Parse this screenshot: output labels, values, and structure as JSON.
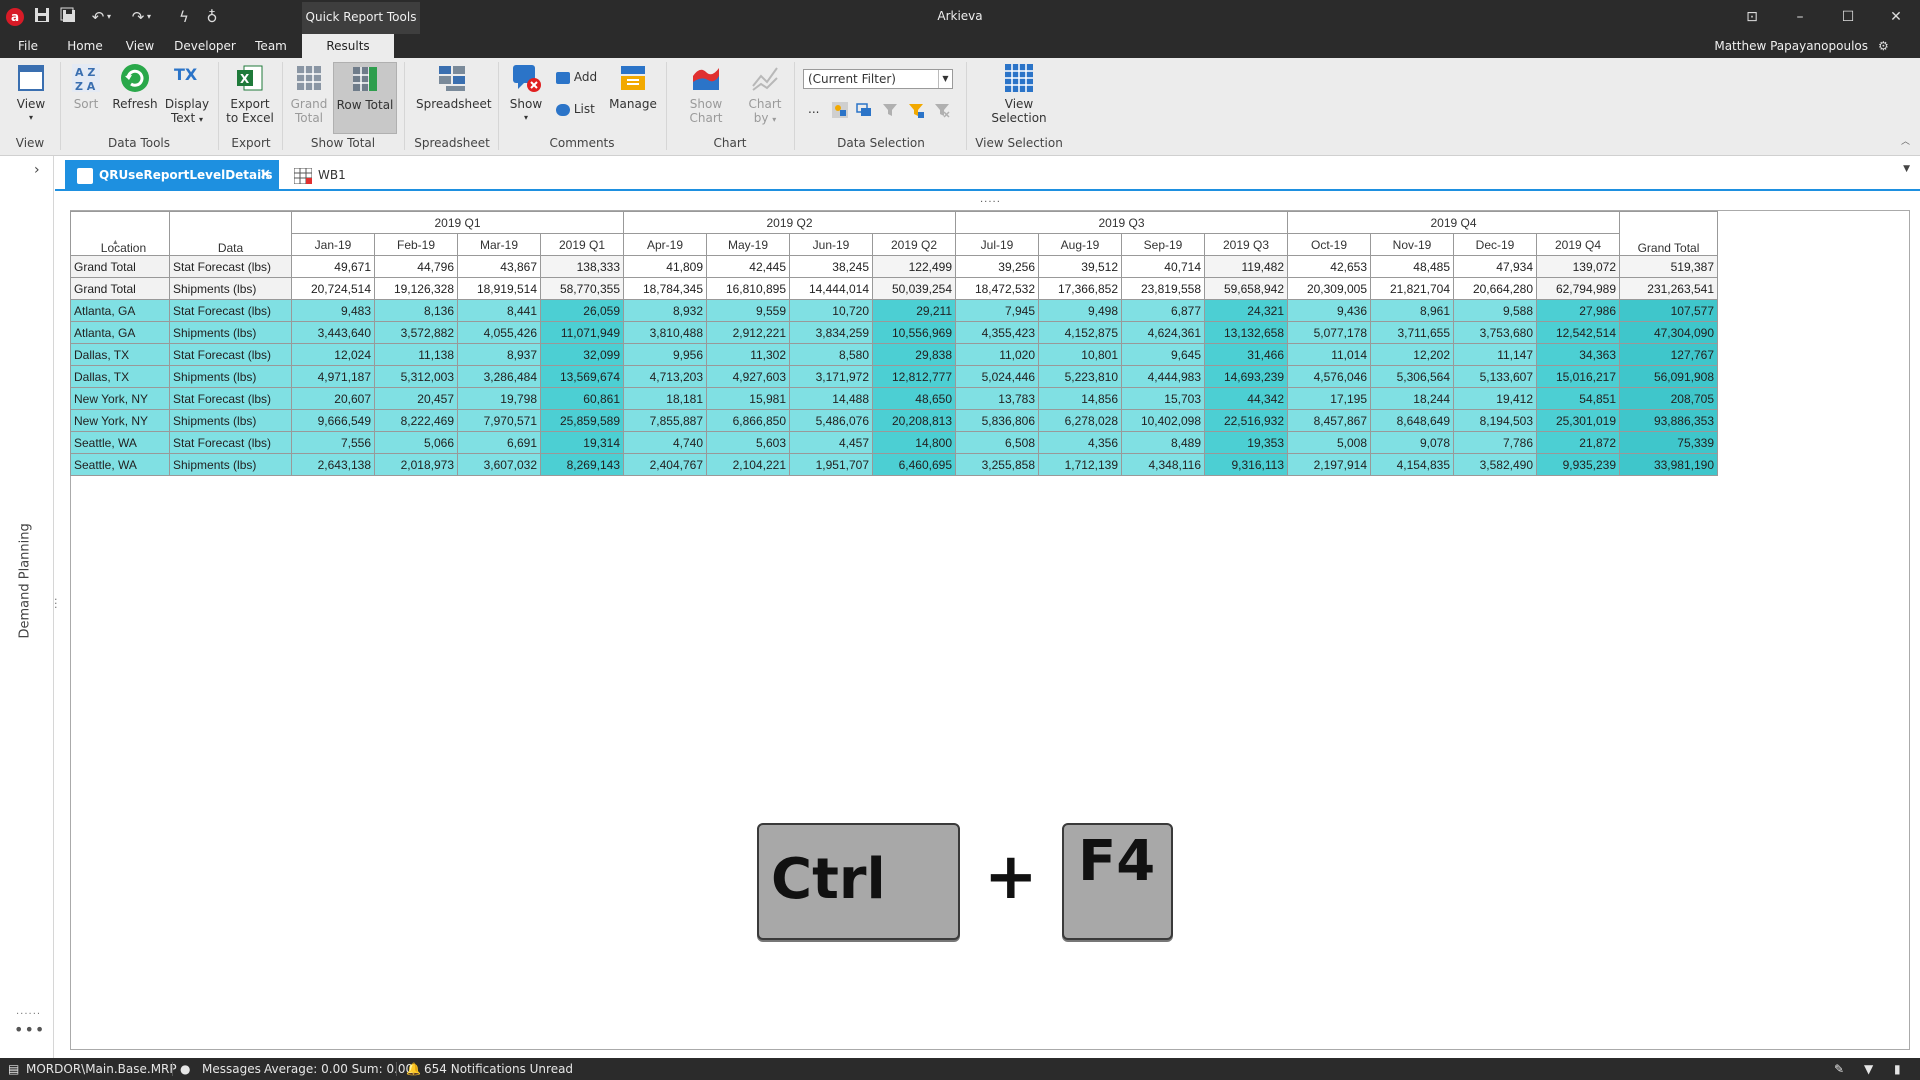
{
  "titlebar": {
    "logo": "a",
    "context_tab": "Quick Report Tools",
    "app_title": "Arkieva",
    "icons": [
      "save-icon",
      "save-all-icon",
      "undo-icon",
      "redo-icon",
      "lightning-icon",
      "lightbulb-icon"
    ],
    "window_buttons": [
      "restore-layout-icon",
      "minimize-icon",
      "maximize-icon",
      "close-icon"
    ]
  },
  "menu": {
    "items": [
      "File",
      "Home",
      "View",
      "Developer",
      "Team",
      "Results"
    ],
    "user": "Matthew Papayanopoulos"
  },
  "ribbon": {
    "view": "View",
    "sort": "Sort",
    "refresh": "Refresh",
    "display_text_1": "Display",
    "display_text_2": "Text",
    "export_excel_1": "Export",
    "export_excel_2": "to Excel",
    "grand_total_1": "Grand",
    "grand_total_2": "Total",
    "row_total": "Row Total",
    "spreadsheet": "Spreadsheet",
    "show": "Show",
    "add": "Add",
    "list": "List",
    "manage": "Manage",
    "show_chart": "Show Chart",
    "chart_by_1": "Chart",
    "chart_by_2": "by",
    "filter_value": "(Current Filter)",
    "ellipsis": "...",
    "view_selection": "View Selection",
    "groups": {
      "view": "View",
      "data_tools": "Data Tools",
      "export": "Export",
      "show_total": "Show Total",
      "spreadsheet": "Spreadsheet",
      "comments": "Comments",
      "chart": "Chart",
      "data_selection": "Data Selection",
      "view_selection": "View Selection"
    }
  },
  "sidebar": {
    "label": "Demand Planning",
    "more": "•••"
  },
  "tabs": {
    "active": "QRUseReportLevelDetails",
    "other": "WB1"
  },
  "grid": {
    "quarters": [
      "2019 Q1",
      "2019 Q2",
      "2019 Q3",
      "2019 Q4"
    ],
    "header_location": "Location",
    "header_data": "Data",
    "columns": [
      "Jan-19",
      "Feb-19",
      "Mar-19",
      "2019 Q1",
      "Apr-19",
      "May-19",
      "Jun-19",
      "2019 Q2",
      "Jul-19",
      "Aug-19",
      "Sep-19",
      "2019 Q3",
      "Oct-19",
      "Nov-19",
      "Dec-19",
      "2019 Q4",
      "Grand Total"
    ],
    "rows": [
      {
        "location": "Grand Total",
        "data": "Stat Forecast (lbs)",
        "values": [
          "49,671",
          "44,796",
          "43,867",
          "138,333",
          "41,809",
          "42,445",
          "38,245",
          "122,499",
          "39,256",
          "39,512",
          "40,714",
          "119,482",
          "42,653",
          "48,485",
          "47,934",
          "139,072",
          "519,387"
        ]
      },
      {
        "location": "Grand Total",
        "data": "Shipments (lbs)",
        "values": [
          "20,724,514",
          "19,126,328",
          "18,919,514",
          "58,770,355",
          "18,784,345",
          "16,810,895",
          "14,444,014",
          "50,039,254",
          "18,472,532",
          "17,366,852",
          "23,819,558",
          "59,658,942",
          "20,309,005",
          "21,821,704",
          "20,664,280",
          "62,794,989",
          "231,263,541"
        ]
      },
      {
        "location": "Atlanta, GA",
        "data": "Stat Forecast (lbs)",
        "values": [
          "9,483",
          "8,136",
          "8,441",
          "26,059",
          "8,932",
          "9,559",
          "10,720",
          "29,211",
          "7,945",
          "9,498",
          "6,877",
          "24,321",
          "9,436",
          "8,961",
          "9,588",
          "27,986",
          "107,577"
        ]
      },
      {
        "location": "Atlanta, GA",
        "data": "Shipments (lbs)",
        "values": [
          "3,443,640",
          "3,572,882",
          "4,055,426",
          "11,071,949",
          "3,810,488",
          "2,912,221",
          "3,834,259",
          "10,556,969",
          "4,355,423",
          "4,152,875",
          "4,624,361",
          "13,132,658",
          "5,077,178",
          "3,711,655",
          "3,753,680",
          "12,542,514",
          "47,304,090"
        ]
      },
      {
        "location": "Dallas, TX",
        "data": "Stat Forecast (lbs)",
        "values": [
          "12,024",
          "11,138",
          "8,937",
          "32,099",
          "9,956",
          "11,302",
          "8,580",
          "29,838",
          "11,020",
          "10,801",
          "9,645",
          "31,466",
          "11,014",
          "12,202",
          "11,147",
          "34,363",
          "127,767"
        ]
      },
      {
        "location": "Dallas, TX",
        "data": "Shipments (lbs)",
        "values": [
          "4,971,187",
          "5,312,003",
          "3,286,484",
          "13,569,674",
          "4,713,203",
          "4,927,603",
          "3,171,972",
          "12,812,777",
          "5,024,446",
          "5,223,810",
          "4,444,983",
          "14,693,239",
          "4,576,046",
          "5,306,564",
          "5,133,607",
          "15,016,217",
          "56,091,908"
        ]
      },
      {
        "location": "New York, NY",
        "data": "Stat Forecast (lbs)",
        "values": [
          "20,607",
          "20,457",
          "19,798",
          "60,861",
          "18,181",
          "15,981",
          "14,488",
          "48,650",
          "13,783",
          "14,856",
          "15,703",
          "44,342",
          "17,195",
          "18,244",
          "19,412",
          "54,851",
          "208,705"
        ]
      },
      {
        "location": "New York, NY",
        "data": "Shipments (lbs)",
        "values": [
          "9,666,549",
          "8,222,469",
          "7,970,571",
          "25,859,589",
          "7,855,887",
          "6,866,850",
          "5,486,076",
          "20,208,813",
          "5,836,806",
          "6,278,028",
          "10,402,098",
          "22,516,932",
          "8,457,867",
          "8,648,649",
          "8,194,503",
          "25,301,019",
          "93,886,353"
        ]
      },
      {
        "location": "Seattle, WA",
        "data": "Stat Forecast (lbs)",
        "values": [
          "7,556",
          "5,066",
          "6,691",
          "19,314",
          "4,740",
          "5,603",
          "4,457",
          "14,800",
          "6,508",
          "4,356",
          "8,489",
          "19,353",
          "5,008",
          "9,078",
          "7,786",
          "21,872",
          "75,339"
        ]
      },
      {
        "location": "Seattle, WA",
        "data": "Shipments (lbs)",
        "values": [
          "2,643,138",
          "2,018,973",
          "3,607,032",
          "8,269,143",
          "2,404,767",
          "2,104,221",
          "1,951,707",
          "6,460,695",
          "3,255,858",
          "1,712,139",
          "4,348,116",
          "9,316,113",
          "2,197,914",
          "4,154,835",
          "3,582,490",
          "9,935,239",
          "33,981,190"
        ]
      }
    ]
  },
  "overlay": {
    "key1": "Ctrl",
    "plus": "+",
    "key2": "F4"
  },
  "status": {
    "db": "MORDOR\\Main.Base.MRP",
    "messages": "Messages",
    "stats": "Average: 0.00 Sum: 0.00",
    "notifications": "654 Notifications Unread"
  },
  "colors": {
    "accent": "#1e90e0",
    "row_teal": "#80e0e3",
    "quarter_teal": "#4ccfd3",
    "chrome_dark": "#2b2b2b"
  }
}
